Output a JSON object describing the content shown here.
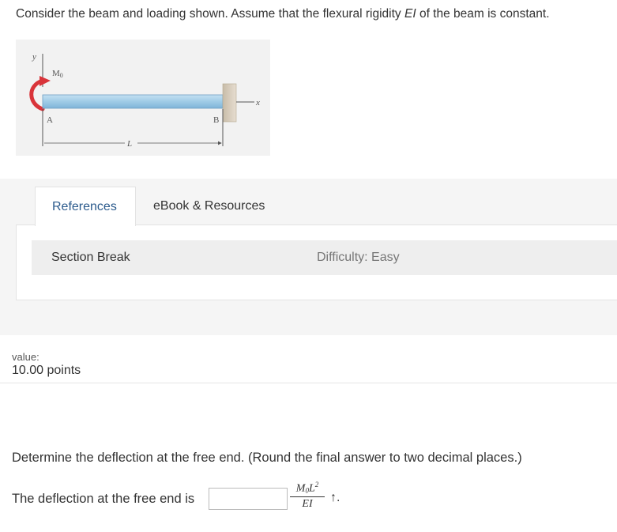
{
  "problem": {
    "intro_prefix": "Consider the beam and loading shown. Assume that the flexural rigidity ",
    "intro_var": "EI",
    "intro_suffix": " of the beam is constant."
  },
  "figure": {
    "label_y": "y",
    "label_moment": "M",
    "label_moment_sub": "0",
    "label_a": "A",
    "label_b": "B",
    "label_x": "x",
    "label_length": "L"
  },
  "references": {
    "tab_references": "References",
    "tab_ebook": "eBook & Resources",
    "section_break": "Section Break",
    "difficulty": "Difficulty: Easy"
  },
  "score": {
    "value_label": "value:",
    "points": "10.00 points"
  },
  "question": {
    "text": "Determine the deflection at the free end. (Round the final answer to two decimal places.)",
    "answer_label": "The deflection at the free end is",
    "answer_value": "",
    "unit_numerator_m": "M",
    "unit_numerator_sub": "0",
    "unit_numerator_l": "L",
    "unit_numerator_sup": "2",
    "unit_denominator": "EI",
    "direction": "↑."
  },
  "colors": {
    "link": "#2b5a8c",
    "moment_arrow": "#d9343a",
    "beam_fill": "#9fcbe6"
  }
}
